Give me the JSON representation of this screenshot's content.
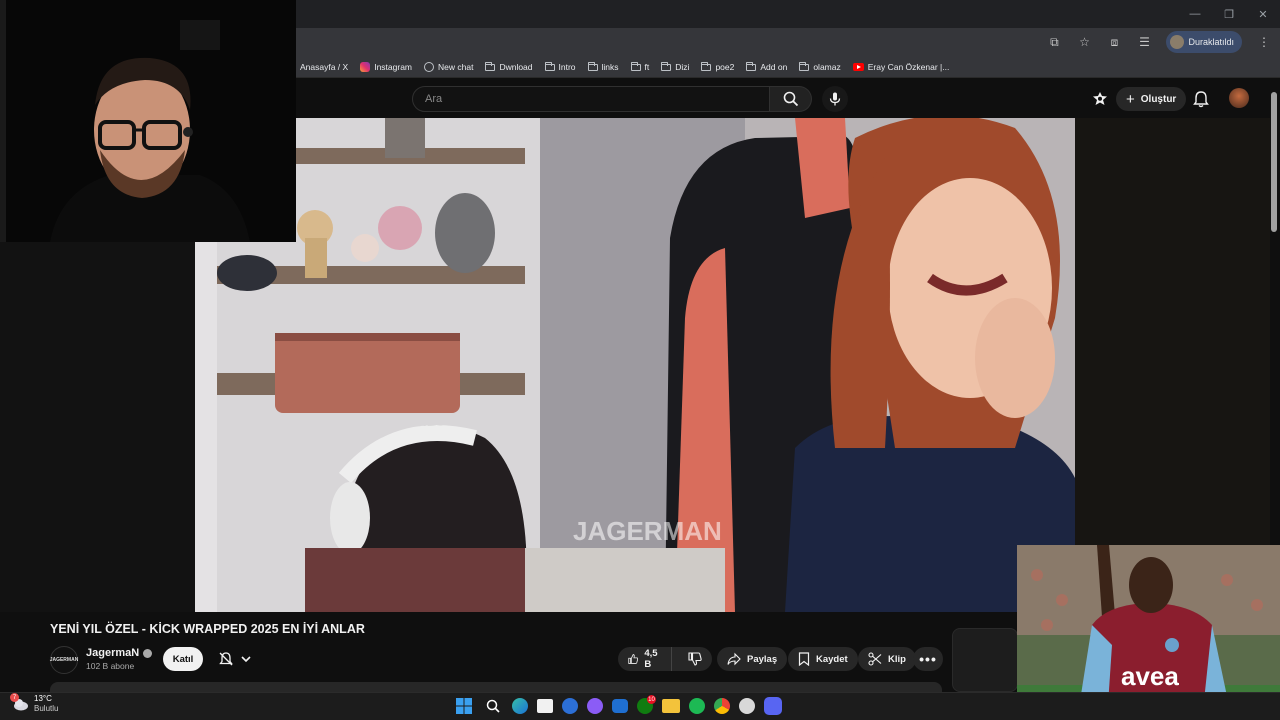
{
  "browser": {
    "profile_label": "Duraklatıldı",
    "bookmarks": [
      {
        "label": "Anasayfa / X",
        "icon": "x-icon"
      },
      {
        "label": "Instagram",
        "icon": "instagram-icon"
      },
      {
        "label": "New chat",
        "icon": "globe-icon"
      },
      {
        "label": "Dwnload",
        "icon": "folder-icon"
      },
      {
        "label": "Intro",
        "icon": "folder-icon"
      },
      {
        "label": "links",
        "icon": "folder-icon"
      },
      {
        "label": "ft",
        "icon": "folder-icon"
      },
      {
        "label": "Dizi",
        "icon": "folder-icon"
      },
      {
        "label": "poe2",
        "icon": "folder-icon"
      },
      {
        "label": "Add on",
        "icon": "folder-icon"
      },
      {
        "label": "olamaz",
        "icon": "folder-icon"
      },
      {
        "label": "Eray Can Özkenar |...",
        "icon": "youtube-icon"
      }
    ]
  },
  "youtube": {
    "search_placeholder": "Ara",
    "create_label": "Oluştur",
    "video": {
      "watermark": "JAGERMAN",
      "title": "YENİ YIL ÖZEL - KİCK WRAPPED 2025 EN İYİ ANLAR",
      "channel_name": "JagermaN",
      "channel_avatar_text": "JAGERMAN",
      "subscribers": "102 B abone",
      "join_label": "Katıl",
      "likes": "4,5 B",
      "share_label": "Paylaş",
      "save_label": "Kaydet",
      "clip_label": "Klip"
    }
  },
  "taskbar": {
    "temperature": "13°C",
    "condition": "Bulutlu",
    "weather_badge": "7",
    "xbox_badge": "10"
  },
  "colors": {
    "accent": "#3c4c6b",
    "yt_red": "#ff0000",
    "jersey_claret": "#8b1e2e",
    "jersey_blue": "#7ab3d9"
  }
}
